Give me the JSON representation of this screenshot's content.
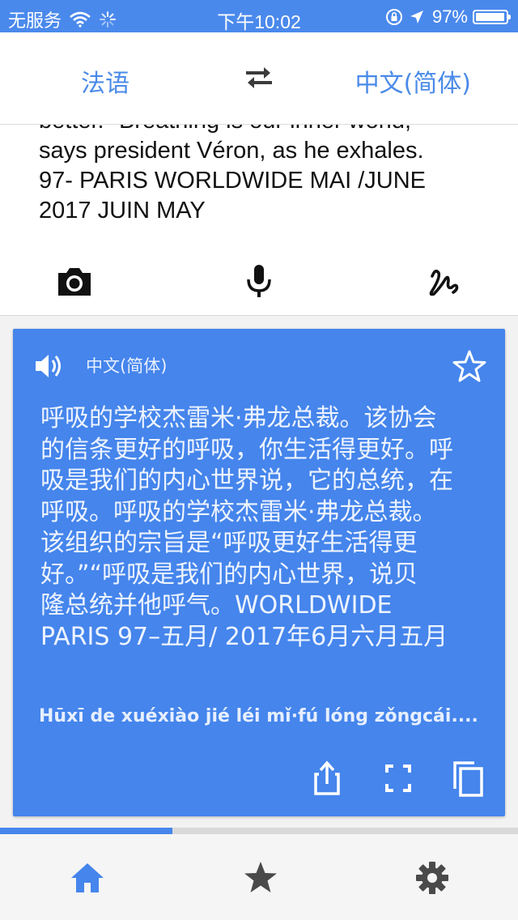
{
  "status_bar": {
    "carrier": "无服务",
    "time": "下午10:02",
    "battery": "97%",
    "battery_level": 0.97
  },
  "language_bar": {
    "source_language": "法语",
    "target_language": "中文(简体)",
    "swap_icon": "swap-arrows-icon"
  },
  "source": {
    "lines": [
      "better.\" Breathing is our inner world,",
      "says president Véron, as he exhales.",
      "97- PARIS WORLDWIDE MAI /JUNE",
      "2017 JUIN MAY"
    ],
    "tools": [
      "camera-icon",
      "microphone-icon",
      "handwriting-icon"
    ]
  },
  "result": {
    "language": "中文(简体)",
    "lines": [
      "呼吸的学校杰雷米·弗龙总裁。该协会",
      "的信条更好的呼吸，你生活得更好。呼",
      "吸是我们的内心世界说，它的总统，在",
      "呼吸。呼吸的学校杰雷米·弗龙总裁。",
      "该组织的宗旨是“呼吸更好生活得更",
      "好。”“呼吸是我们的内心世界，说贝",
      "隆总统并他呼气。WORLDWIDE",
      "PARIS 97–五月/ 2017年6月六月五月"
    ],
    "pinyin": "Hūxī de xuéxiào jié léi mǐ·fú lóng zǒngcái....",
    "actions": [
      "share-icon",
      "fullscreen-icon",
      "copy-icon"
    ]
  },
  "progress": {
    "value": 0.333
  },
  "bottom_nav": {
    "items": [
      "home-icon",
      "star-icon",
      "settings-icon"
    ],
    "active": "home",
    "colors": {
      "active": "#4585ec",
      "inactive": "#4a4a4a"
    }
  }
}
